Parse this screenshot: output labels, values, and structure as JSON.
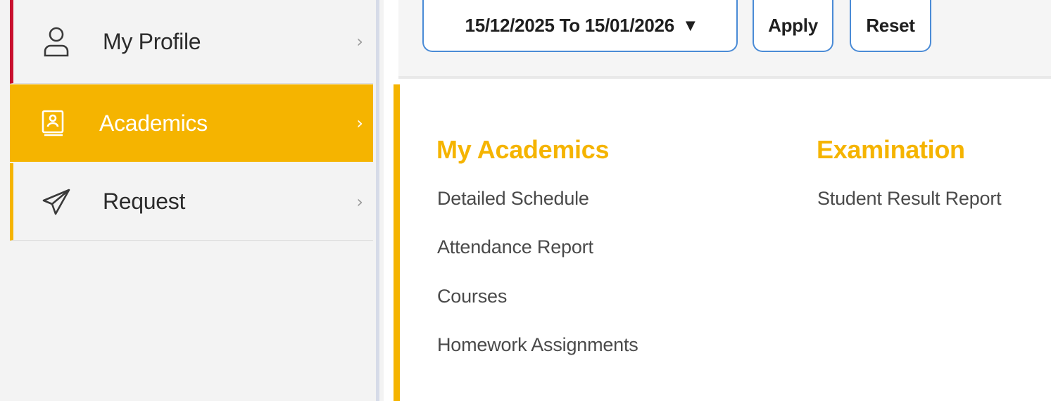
{
  "sidebar": {
    "items": [
      {
        "label": "My Profile",
        "icon": "user-icon"
      },
      {
        "label": "Academics",
        "icon": "book-icon"
      },
      {
        "label": "Request",
        "icon": "paper-plane-icon"
      }
    ],
    "chevron": "›"
  },
  "filter": {
    "date_range": "15/12/2025 To 15/01/2026",
    "dropdown_arrow": "▼",
    "apply_label": "Apply",
    "reset_label": "Reset"
  },
  "main": {
    "sections": [
      {
        "title": "My Academics",
        "links": [
          "Detailed Schedule",
          "Attendance Report",
          "Courses",
          "Homework Assignments"
        ]
      },
      {
        "title": "Examination",
        "links": [
          "Student Result Report"
        ]
      }
    ]
  },
  "colors": {
    "accent": "#f5b400",
    "active_marker": "#c8102e",
    "button_border": "#4a8bd6"
  }
}
